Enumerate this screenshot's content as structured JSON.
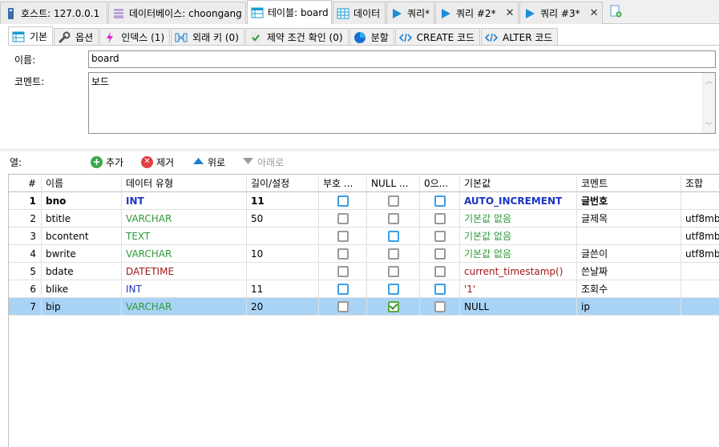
{
  "doc_tabs": [
    {
      "label": "호스트: 127.0.0.1",
      "icon": "server-icon"
    },
    {
      "label": "데이터베이스: choongang",
      "icon": "database-icon"
    },
    {
      "label": "테이블: board",
      "icon": "table-icon",
      "active": true
    },
    {
      "label": "데이터",
      "icon": "grid-icon"
    },
    {
      "label": "쿼리*",
      "icon": "play-icon"
    },
    {
      "label": "쿼리 #2*",
      "icon": "play-icon",
      "closable": true
    },
    {
      "label": "쿼리 #3*",
      "icon": "play-icon",
      "closable": true
    }
  ],
  "sub_tabs": [
    {
      "label": "기본",
      "icon": "table-icon"
    },
    {
      "label": "옵션",
      "icon": "wrench-icon"
    },
    {
      "label": "인덱스 (1)",
      "icon": "lightning-icon"
    },
    {
      "label": "외래 키 (0)",
      "icon": "foreign-key-icon"
    },
    {
      "label": "제약 조건 확인 (0)",
      "icon": "check-icon"
    },
    {
      "label": "분할",
      "icon": "pie-icon"
    },
    {
      "label": "CREATE 코드",
      "icon": "code-icon"
    },
    {
      "label": "ALTER 코드",
      "icon": "code-icon"
    }
  ],
  "form": {
    "name_label": "이름:",
    "name_value": "board",
    "comment_label": "코멘트:",
    "comment_value": "보드"
  },
  "toolbar": {
    "columns_label": "열:",
    "add": "추가",
    "remove": "제거",
    "up": "위로",
    "down": "아래로"
  },
  "grid": {
    "headers": [
      "#",
      "이름",
      "데이터 유형",
      "길이/설정",
      "부호 ...",
      "NULL ...",
      "0으...",
      "기본값",
      "코멘트",
      "조합"
    ],
    "rows": [
      {
        "num": "1",
        "name": "bno",
        "type": "INT",
        "length": "11",
        "default": "AUTO_INCREMENT",
        "comment": "글번호",
        "collation": "",
        "unsigned": false,
        "null": false,
        "zerofill": false,
        "primary": true
      },
      {
        "num": "2",
        "name": "btitle",
        "type": "VARCHAR",
        "length": "50",
        "default": "기본값 없음",
        "comment": "글제목",
        "collation": "utf8mb",
        "unsigned": false,
        "null": false,
        "zerofill": false
      },
      {
        "num": "3",
        "name": "bcontent",
        "type": "TEXT",
        "length": "",
        "default": "기본값 없음",
        "comment": "",
        "collation": "utf8mb",
        "unsigned": false,
        "null": false,
        "zerofill": false
      },
      {
        "num": "4",
        "name": "bwrite",
        "type": "VARCHAR",
        "length": "10",
        "default": "기본값 없음",
        "comment": "글쓴이",
        "collation": "utf8mb",
        "unsigned": false,
        "null": false,
        "zerofill": false
      },
      {
        "num": "5",
        "name": "bdate",
        "type": "DATETIME",
        "length": "",
        "default": "current_timestamp()",
        "comment": "쓴날짜",
        "collation": "",
        "unsigned": false,
        "null": false,
        "zerofill": false
      },
      {
        "num": "6",
        "name": "blike",
        "type": "INT",
        "length": "11",
        "default": "'1'",
        "comment": "조회수",
        "collation": "",
        "unsigned": false,
        "null": false,
        "zerofill": false
      },
      {
        "num": "7",
        "name": "bip",
        "type": "VARCHAR",
        "length": "20",
        "default": "NULL",
        "comment": "ip",
        "collation": "",
        "unsigned": false,
        "null": true,
        "zerofill": false,
        "selected": true
      }
    ]
  }
}
